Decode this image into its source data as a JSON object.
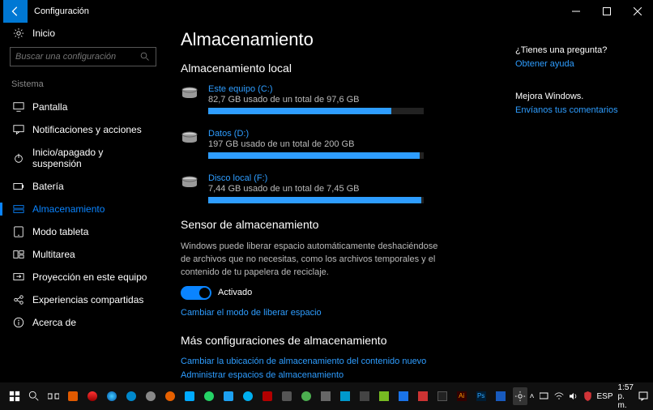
{
  "titlebar": {
    "title": "Configuración"
  },
  "sidebar": {
    "home": "Inicio",
    "search_placeholder": "Buscar una configuración",
    "category": "Sistema",
    "items": [
      {
        "label": "Pantalla",
        "icon": "display-icon"
      },
      {
        "label": "Notificaciones y acciones",
        "icon": "chat-icon"
      },
      {
        "label": "Inicio/apagado y suspensión",
        "icon": "power-icon"
      },
      {
        "label": "Batería",
        "icon": "battery-icon"
      },
      {
        "label": "Almacenamiento",
        "icon": "storage-icon",
        "active": true
      },
      {
        "label": "Modo tableta",
        "icon": "tablet-icon"
      },
      {
        "label": "Multitarea",
        "icon": "multitask-icon"
      },
      {
        "label": "Proyección en este equipo",
        "icon": "project-icon"
      },
      {
        "label": "Experiencias compartidas",
        "icon": "share-icon"
      },
      {
        "label": "Acerca de",
        "icon": "info-icon"
      }
    ]
  },
  "main": {
    "heading": "Almacenamiento",
    "local_heading": "Almacenamiento local",
    "drives": [
      {
        "name": "Este equipo (C:)",
        "usage": "82,7 GB usado de un total de 97,6 GB",
        "pct": 85
      },
      {
        "name": "Datos (D:)",
        "usage": "197 GB usado de un total de 200 GB",
        "pct": 98
      },
      {
        "name": "Disco local (F:)",
        "usage": "7,44 GB usado de un total de 7,45 GB",
        "pct": 99
      }
    ],
    "sensor_heading": "Sensor de almacenamiento",
    "sensor_desc": "Windows puede liberar espacio automáticamente deshaciéndose de archivos que no necesitas, como los archivos temporales y el contenido de tu papelera de reciclaje.",
    "toggle_state": "Activado",
    "change_link": "Cambiar el modo de liberar espacio",
    "more_heading": "Más configuraciones de almacenamiento",
    "more_links": [
      "Cambiar la ubicación de almacenamiento del contenido nuevo",
      "Administrar espacios de almacenamiento"
    ]
  },
  "aside": {
    "question_label": "¿Tienes una pregunta?",
    "help_link": "Obtener ayuda",
    "improve_label": "Mejora Windows.",
    "feedback_link": "Envíanos tus comentarios"
  },
  "taskbar": {
    "clock": "1:57 p. m.",
    "lang": "ESP"
  },
  "colors": {
    "accent": "#2e9dff"
  }
}
